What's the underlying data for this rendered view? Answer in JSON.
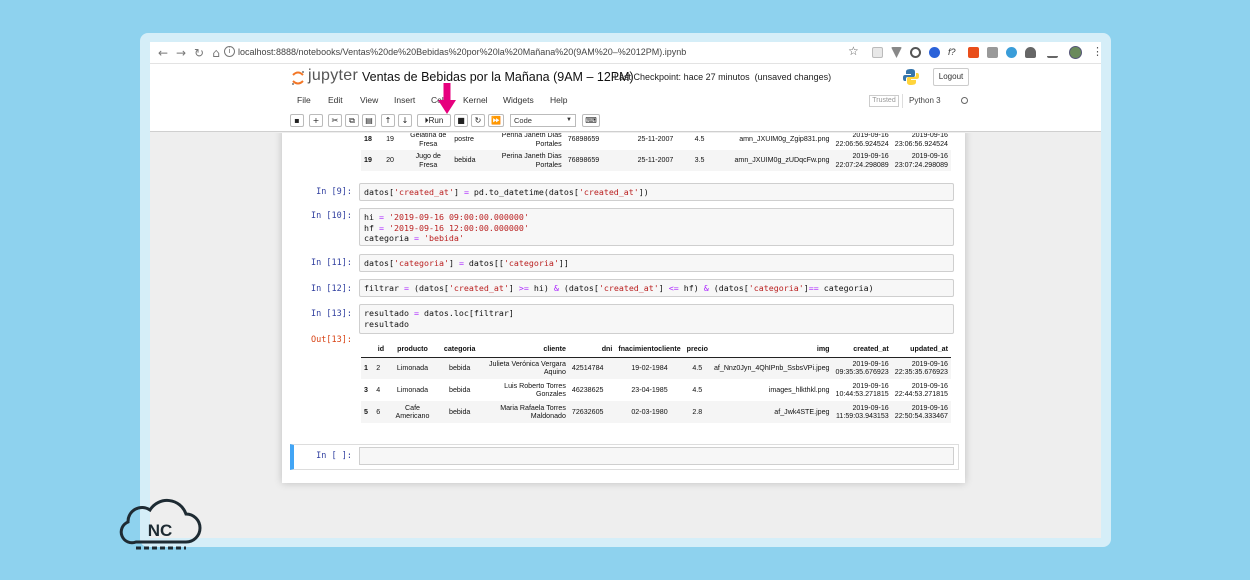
{
  "browser": {
    "url": "localhost:8888/notebooks/Ventas%20de%20Bebidas%20por%20la%20Mañana%20(9AM%20–%2012PM).ipynb"
  },
  "header": {
    "logo_text": "jupyter",
    "notebook_title": "Ventas de Bebidas por la Mañana (9AM – 12PM)",
    "checkpoint_label": "Last Checkpoint:",
    "checkpoint_time": "hace 27 minutos",
    "unsaved": "(unsaved changes)",
    "logout": "Logout"
  },
  "menu": [
    "File",
    "Edit",
    "View",
    "Insert",
    "Cell",
    "Kernel",
    "Widgets",
    "Help"
  ],
  "status": {
    "trusted": "Trusted",
    "kernel": "Python 3"
  },
  "toolbar": {
    "run_label": "Run",
    "cell_type": "Code"
  },
  "prev_table": [
    {
      "index": "18",
      "id": "19",
      "producto": "Gelatina de Fresa",
      "categoria": "postre",
      "cliente": "Perina Janeth Dias Portales",
      "dni": "76898659",
      "fnac": "25-11-2007",
      "precio": "4.5",
      "img": "amn_JXUIM0g_Zgip831.png",
      "created": "2019-09-16 22:06:56.924524",
      "updated": "2019-09-16 23:06:56.924524"
    },
    {
      "index": "19",
      "id": "20",
      "producto": "Jugo de Fresa",
      "categoria": "bebida",
      "cliente": "Perina Janeth Dias Portales",
      "dni": "76898659",
      "fnac": "25-11-2007",
      "precio": "3.5",
      "img": "amn_JXUIM0g_zUDqcFw.png",
      "created": "2019-09-16 22:07:24.298089",
      "updated": "2019-09-16 23:07:24.298089"
    }
  ],
  "cells": {
    "c9_prompt": "In [9]:",
    "c10_prompt": "In [10]:",
    "c11_prompt": "In [11]:",
    "c12_prompt": "In [12]:",
    "c13_prompt": "In [13]:",
    "out13_prompt": "Out[13]:",
    "empty_prompt": "In [ ]:",
    "c10_hi_value": "'2019-09-16 09:00:00.000000'",
    "c10_hf_value": "'2019-09-16 12:00:00.000000'",
    "c10_cat_value": "'bebida'"
  },
  "result_table": {
    "headers": [
      "id",
      "producto",
      "categoria",
      "cliente",
      "dni",
      "fnacimientocliente",
      "precio",
      "img",
      "created_at",
      "updated_at"
    ],
    "rows": [
      {
        "index": "1",
        "id": "2",
        "producto": "Limonada",
        "categoria": "bebida",
        "cliente": "Julieta Verónica Vergara Aquino",
        "dni": "42514784",
        "fnac": "19-02-1984",
        "precio": "4.5",
        "img": "af_Nnz0Jyn_4QhIPnb_SsbsVPi.jpeg",
        "created": "2019-09-16 09:35:35.676923",
        "updated": "2019-09-16 22:35:35.676923"
      },
      {
        "index": "3",
        "id": "4",
        "producto": "Limonada",
        "categoria": "bebida",
        "cliente": "Luis Roberto Torres Gonzales",
        "dni": "46238625",
        "fnac": "23-04-1985",
        "precio": "4.5",
        "img": "images_hlkthkl.png",
        "created": "2019-09-16 10:44:53.271815",
        "updated": "2019-09-16 22:44:53.271815"
      },
      {
        "index": "5",
        "id": "6",
        "producto": "Cafe Americano",
        "categoria": "bebida",
        "cliente": "Maria Rafaela Torres Maldonado",
        "dni": "72632605",
        "fnac": "02-03-1980",
        "precio": "2.8",
        "img": "af_Jwk4STE.jpeg",
        "created": "2019-09-16 11:59:03.943153",
        "updated": "2019-09-16 22:50:54.333467"
      }
    ]
  },
  "watermark": {
    "text": "NC"
  },
  "colors": {
    "background": "#8ed2ee",
    "arrow": "#e6007e",
    "in_prompt": "#303f9f",
    "out_prompt": "#d84315",
    "active_cell": "#42a5f5"
  }
}
